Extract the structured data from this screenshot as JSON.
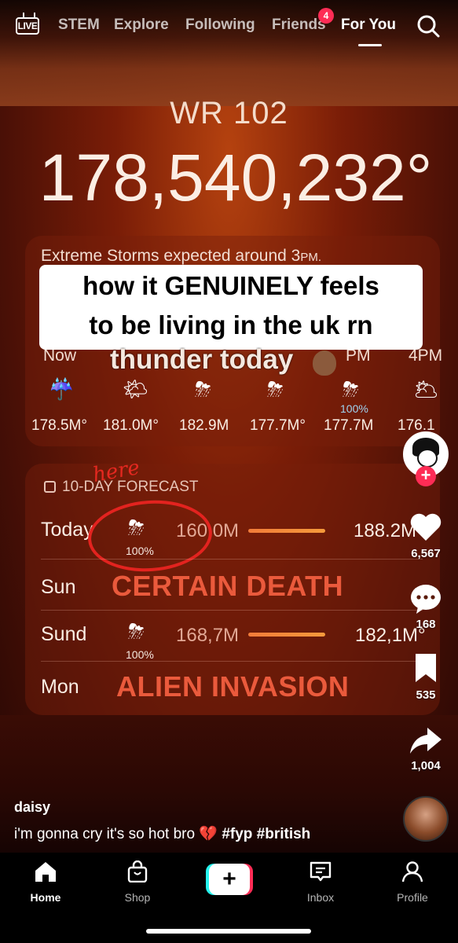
{
  "topnav": {
    "live_label": "LIVE",
    "tabs": [
      "STEM",
      "Explore",
      "Following",
      "Friends",
      "For You"
    ],
    "friends_badge": "4",
    "active_tab": "For You"
  },
  "video": {
    "wr_label": "WR 102",
    "big_temp": "178,540,232°",
    "storm_text": "Extreme Storms expected around 3",
    "storm_text_suffix": "PM.",
    "caption_line1": "how it GENUINELY feels",
    "caption_line2": "to be living in the uk rn",
    "thunder_text": "thunder today",
    "hourly": [
      {
        "label": "Now",
        "icon": "☔",
        "temp": "178.5M°"
      },
      {
        "label": "",
        "icon": "🌤",
        "temp": "181.0M°"
      },
      {
        "label": "",
        "icon": "⛈",
        "temp": "182.9M"
      },
      {
        "label": "",
        "icon": "⛈",
        "temp": "177.7M°"
      },
      {
        "label": "PM",
        "icon": "⛈",
        "temp": "177.7M",
        "pct": "100%"
      },
      {
        "label": "4PM",
        "icon": "🌥",
        "temp": "176.1"
      }
    ],
    "forecast_header": "10-DAY FORECAST",
    "here_annotation": "here",
    "days": [
      {
        "name": "Today",
        "icon": "⛈",
        "pct": "100%",
        "low": "160,0M",
        "high": "188.2M°"
      },
      {
        "name": "Sun",
        "overlay": "CERTAIN DEATH"
      },
      {
        "name": "Sund",
        "icon": "⛈",
        "pct": "100%",
        "low": "168,7M",
        "high": "182,1M°"
      },
      {
        "name": "Mon",
        "overlay": "ALIEN INVASION"
      }
    ]
  },
  "rail": {
    "likes": "6,567",
    "comments": "168",
    "saves": "535",
    "shares": "1,004"
  },
  "post": {
    "username": "daisy",
    "description": "i'm gonna cry it's so hot bro",
    "emoji": "💔",
    "hashtags": "#fyp #british"
  },
  "bottomnav": {
    "items": [
      "Home",
      "Shop",
      "Inbox",
      "Profile"
    ],
    "create_label": "+"
  }
}
